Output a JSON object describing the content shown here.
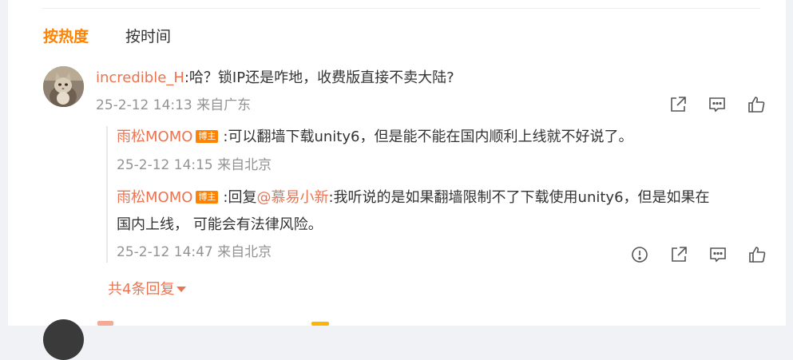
{
  "tabs": {
    "hot": "按热度",
    "time": "按时间"
  },
  "comment": {
    "user": "incredible_H",
    "text": ":哈？锁IP还是咋地，收费版直接不卖大陆?",
    "time": "25-2-12 14:13",
    "location": "来自广东"
  },
  "replies": [
    {
      "user": "雨松MOMO",
      "badge": "博主",
      "text": ":可以翻墙下载unity6，但是能不能在国内顺利上线就不好说了。",
      "time": "25-2-12 14:15",
      "location": "来自北京"
    },
    {
      "user": "雨松MOMO",
      "badge": "博主",
      "prefix": ":回复",
      "mention": "@慕易小新",
      "text_line1": ":我听说的是如果翻墙限制不了下载使用unity6，但是如果在",
      "text_line2": "国内上线， 可能会有法律风险。",
      "time": "25-2-12 14:47",
      "location": "来自北京"
    }
  ],
  "more_replies": "共4条回复",
  "icons": [
    "report-icon",
    "share-icon",
    "comment-icon",
    "like-icon"
  ],
  "colors": {
    "accent": "#ff8200",
    "username": "#eb7350",
    "meta": "#939393"
  }
}
